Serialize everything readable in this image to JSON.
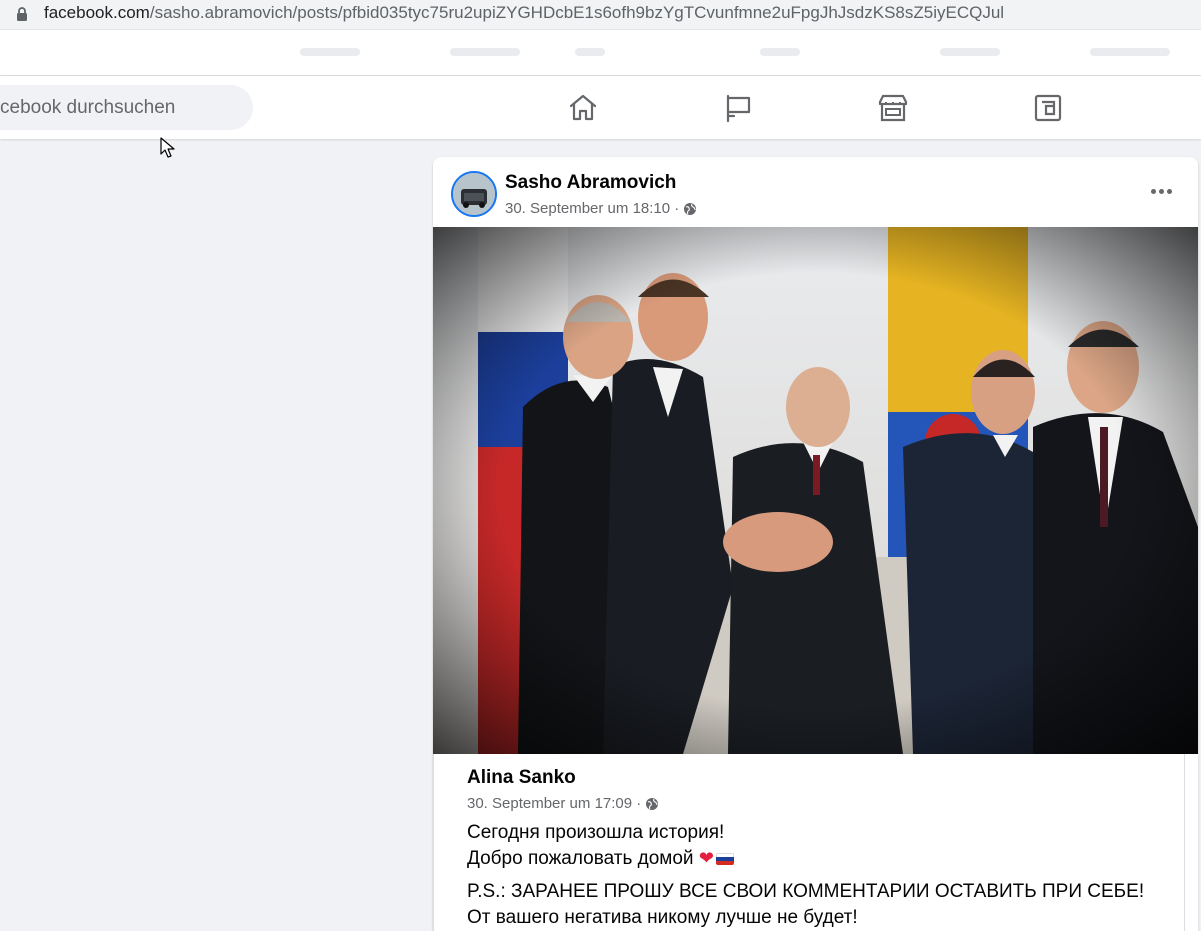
{
  "browser": {
    "url_domain": "facebook.com",
    "url_path": "/sasho.abramovich/posts/pfbid035tyc75ru2upiZYGHDcbE1s6ofh9bzYgTCvunfmne2uFpgJhJsdzKS8sZ5iyECQJul"
  },
  "header": {
    "search_placeholder": "cebook durchsuchen",
    "nav": [
      {
        "name": "home",
        "icon": "home-icon"
      },
      {
        "name": "pages",
        "icon": "flag-icon"
      },
      {
        "name": "marketplace",
        "icon": "shop-icon"
      },
      {
        "name": "gaming",
        "icon": "gaming-icon"
      }
    ]
  },
  "post": {
    "author": "Sasho Abramovich",
    "timestamp": "30. September um 18:10 ·",
    "privacy_icon": "globe-icon",
    "more_icon": "more-options-icon"
  },
  "shared_post": {
    "author": "Alina Sanko",
    "timestamp": "30. September um 17:09 ·",
    "privacy_icon": "globe-icon",
    "line1": "Сегодня произошла история!",
    "line2": "Добро пожаловать домой",
    "line3": "P.S.: ЗАРАНЕЕ ПРОШУ ВСЕ СВОИ КОММЕНТАРИИ ОСТАВИТЬ ПРИ СЕБЕ!",
    "line4": "От вашего негатива никому лучше не будет!"
  },
  "colors": {
    "facebook_blue": "#1877f2",
    "secondary_text": "#65676b",
    "background": "#f0f2f5"
  }
}
